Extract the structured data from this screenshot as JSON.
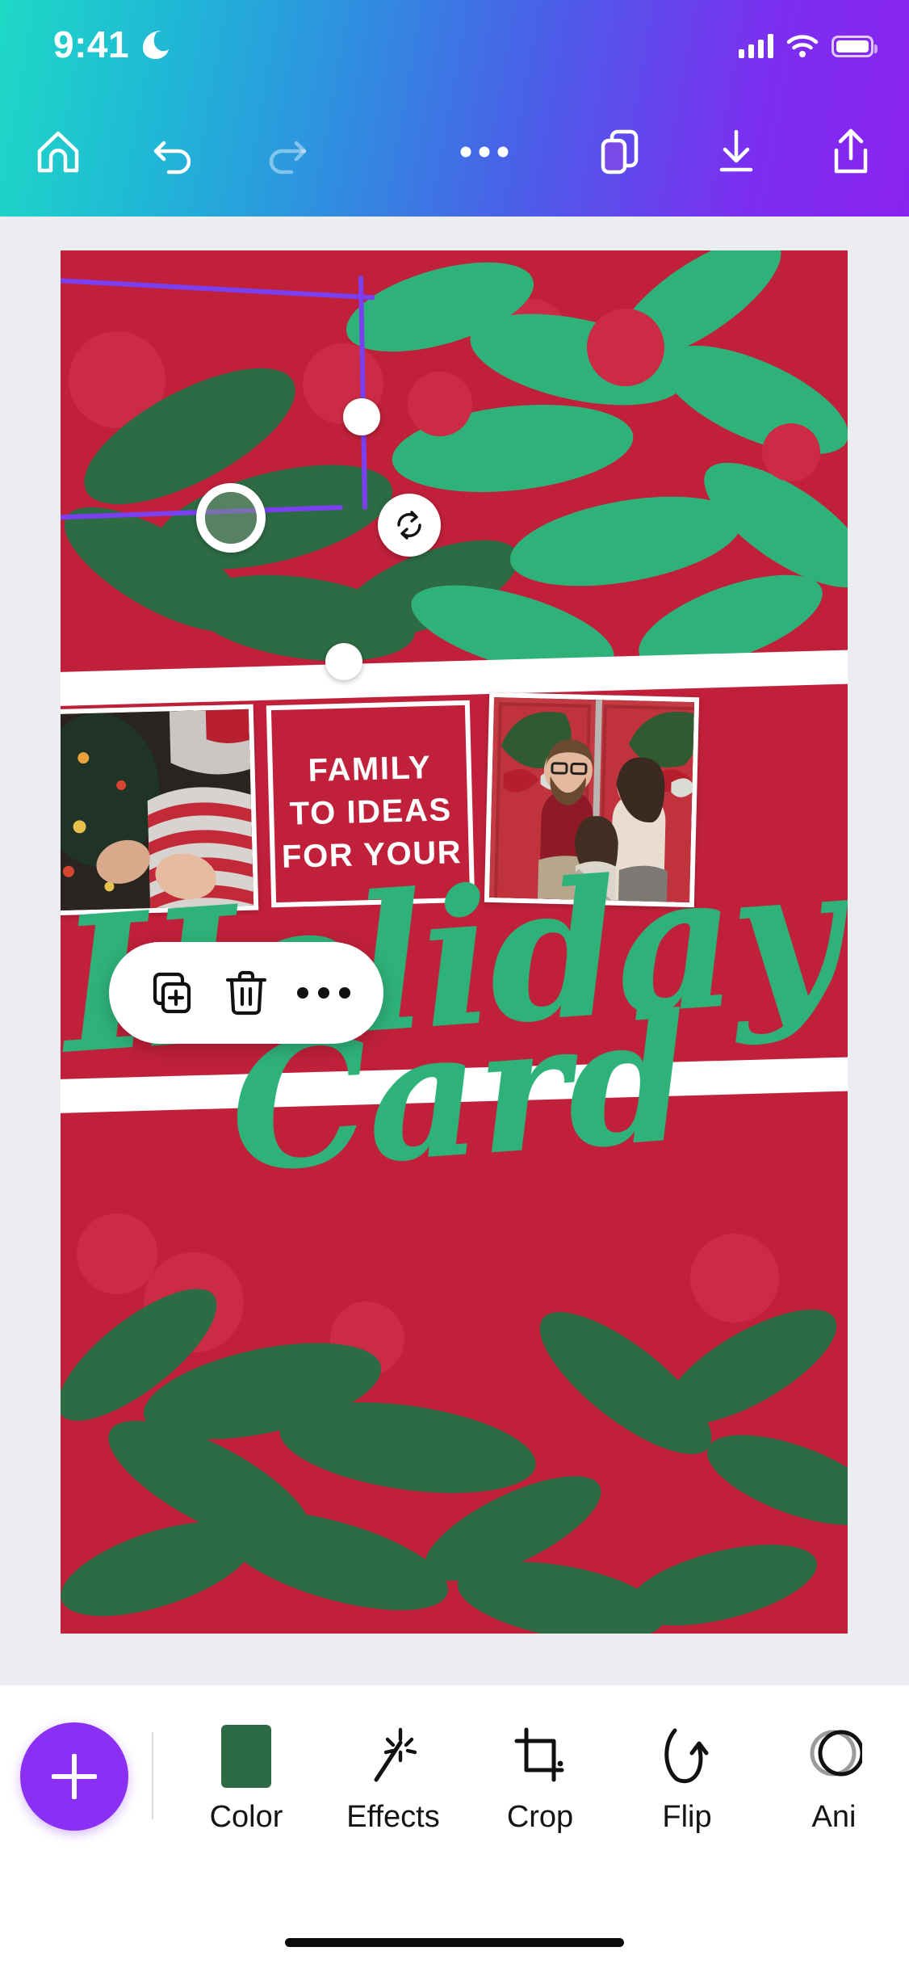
{
  "status_bar": {
    "time": "9:41",
    "dnd_icon": "moon-icon",
    "signal_icon": "cellular-signal-icon",
    "wifi_icon": "wifi-icon",
    "battery_icon": "battery-icon"
  },
  "top_nav": {
    "items": [
      {
        "name": "home-button",
        "icon": "home-icon",
        "enabled": true
      },
      {
        "name": "undo-button",
        "icon": "undo-icon",
        "enabled": true
      },
      {
        "name": "redo-button",
        "icon": "redo-icon",
        "enabled": false
      },
      {
        "name": "more-options-button",
        "icon": "ellipsis-icon",
        "enabled": true
      },
      {
        "name": "pages-button",
        "icon": "pages-layers-icon",
        "enabled": true
      },
      {
        "name": "download-button",
        "icon": "download-icon",
        "enabled": true
      },
      {
        "name": "share-button",
        "icon": "share-upload-icon",
        "enabled": true
      }
    ]
  },
  "canvas": {
    "background_color": "#c0203a",
    "leaf_color": "#2d6b45",
    "accent_green": "#2fb27a",
    "berry_color": "#cc2b45",
    "headline_lines": [
      "FAMILY",
      "TO IDEAS",
      "FOR YOUR"
    ],
    "script_line_1": "Holiday",
    "script_line_2": "Card",
    "photos": [
      {
        "name": "photo-child-pajamas",
        "alt": "child in striped pajamas by christmas tree"
      },
      {
        "name": "photo-family-door",
        "alt": "family of three in front of red door with wreaths"
      }
    ]
  },
  "selection": {
    "outline_color": "#7b3ff2",
    "handle_color": "#ffffff",
    "rotate_icon": "rotate-icon",
    "corner_handles": [
      "top-left-handle",
      "top-right-handle",
      "bottom-left-handle",
      "bottom-right-handle"
    ],
    "crop_handle": "image-crop-handle"
  },
  "floating_toolbar": {
    "duplicate_icon": "duplicate-icon",
    "delete_icon": "trash-icon",
    "more_icon": "ellipsis-icon"
  },
  "bottom_bar": {
    "add_button": {
      "name": "add-element-button",
      "icon": "plus-icon",
      "color": "#8b2ff4"
    },
    "tools": [
      {
        "label": "Color",
        "icon": "color-swatch-icon",
        "swatch": "#2d6b45"
      },
      {
        "label": "Effects",
        "icon": "magic-wand-icon"
      },
      {
        "label": "Crop",
        "icon": "crop-icon"
      },
      {
        "label": "Flip",
        "icon": "flip-icon"
      },
      {
        "label": "Ani",
        "icon": "animate-icon"
      }
    ]
  }
}
